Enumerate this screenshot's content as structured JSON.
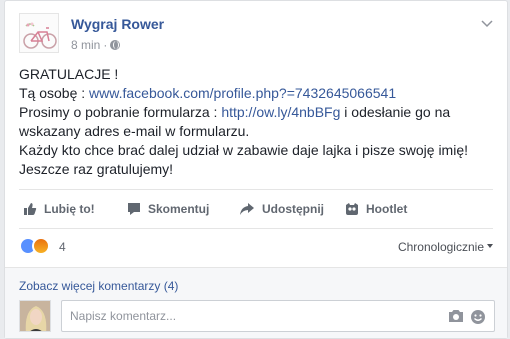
{
  "post": {
    "page_name": "Wygraj Rower",
    "time": "8 min",
    "dot": "·",
    "lines": [
      {
        "text": "GRATULACJE !"
      },
      {
        "prefix": "Tą osobę : ",
        "link": "www.facebook.com/profile.php?=7432645066541"
      },
      {
        "prefix": "Prosimy o pobranie formularza : ",
        "link": "http://ow.ly/4nbBFg",
        "suffix": " i odesłanie go na"
      },
      {
        "text": "wskazany adres e-mail w formularzu."
      },
      {
        "text": "Każdy kto chce brać dalej udział w zabawie daje lajka i pisze swoję imię!"
      },
      {
        "text": "Jeszcze raz gratulujemy!"
      }
    ]
  },
  "actions": {
    "like": "Lubię to!",
    "comment": "Skomentuj",
    "share": "Udostępnij",
    "hootlet": "Hootlet"
  },
  "reactions": {
    "count": "4",
    "order": "Chronologicznie",
    "colors": {
      "like": "#5890ff",
      "angry": "#e9710f"
    }
  },
  "comments": {
    "more": "Zobacz więcej komentarzy (4)",
    "placeholder": "Napisz komentarz..."
  },
  "icons": [
    "bicycle-avatar",
    "globe-icon",
    "chevron-down-icon",
    "like-icon",
    "comment-icon",
    "share-icon",
    "hootlet-icon",
    "camera-icon",
    "sticker-icon"
  ]
}
